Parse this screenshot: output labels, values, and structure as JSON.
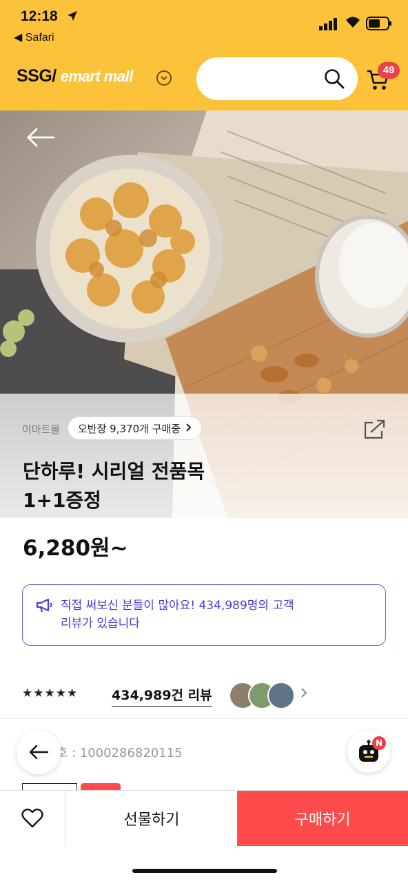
{
  "status_bar": {
    "time": "12:18",
    "back_app": "Safari"
  },
  "header": {
    "logo_ssg": "SSG/",
    "logo_emart": "emart mall",
    "cart_count": "49",
    "colors": {
      "background": "#fcc33a",
      "badge": "#e8424a"
    }
  },
  "product": {
    "seller": "이마트몰",
    "sold_text": "오반장 9,370개 구매중",
    "title_line1": "단하루! 시리얼 전품목",
    "title_line2": "1+1증정",
    "price": "6,280원~",
    "notice": "직접 써보신 분들이 많아요! 434,989명의 고객 리뷰가 있습니다",
    "rating_stars": "★★★★★",
    "review_link": "434,989건 리뷰",
    "product_code": "상품번호 : 1000286820115",
    "chatbot_badge": "N"
  },
  "bottom_bar": {
    "gift_label": "선물하기",
    "buy_label": "구매하기",
    "colors": {
      "buy": "#ff4b4b"
    }
  },
  "icons": [
    "location-arrow-icon",
    "signal-icon",
    "wifi-icon",
    "battery-icon",
    "chevron-down-icon",
    "search-icon",
    "cart-icon",
    "back-arrow-icon",
    "share-icon",
    "megaphone-icon",
    "chevron-right-icon",
    "heart-icon",
    "chatbot-icon"
  ]
}
